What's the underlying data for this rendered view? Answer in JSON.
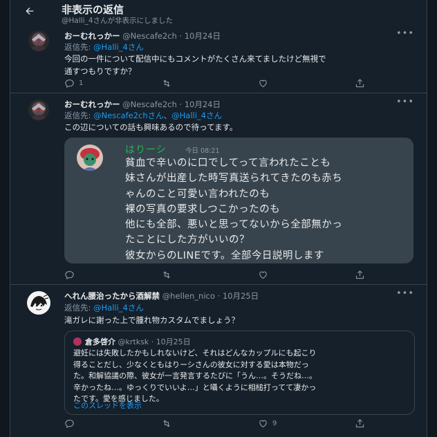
{
  "header": {
    "back_icon": "arrow-left-icon",
    "title": "非表示の返信",
    "subtitle": "@Halli_4さんが非表示にしました"
  },
  "tweets": [
    {
      "name": "おーむれっかー",
      "handle": "@Nescafe2ch",
      "sep": "·",
      "date": "10月24日",
      "reply_prefix": "返信先: ",
      "mentions": [
        "@Halli_4さん"
      ],
      "text": [
        "今回の一件について配信中にもコメントがたくさん来てましたけど無視で",
        "通すつもりですか？"
      ],
      "actions": {
        "reply": "1",
        "retweet": "",
        "like": ""
      }
    },
    {
      "name": "おーむれっかー",
      "handle": "@Nescafe2ch",
      "sep": "·",
      "date": "10月24日",
      "reply_prefix": "返信先: ",
      "mention_1": "@Nescafe2chさん",
      "joiner": "、",
      "mention_2": "@Halli_4さん",
      "text": [
        "この辺についての話も興味あるので待ってます。"
      ],
      "chat_image": {
        "sender": "はりーシ",
        "time": "今日 08:21",
        "lines": [
          "貧血で辛いのに口でしてって言われたことも",
          "妹さんが出産した時写真送られてきたのも赤ち",
          "ゃんのこと可愛い言われたのも",
          "裸の写真の要求しつこかったのも",
          "他にも全部、悪いと思ってないから全部無かっ",
          "たことにした方がいいの？",
          "彼女からのLINEです。全部今日説明します"
        ]
      },
      "actions": {
        "reply": "",
        "retweet": "",
        "like": ""
      }
    },
    {
      "name": "へれん腰治ったから酒解禁",
      "handle": "@hellen_nico",
      "sep": "·",
      "date": "10月25日",
      "reply_prefix": "返信先: ",
      "mentions": [
        "@Halli_4さん"
      ],
      "text": [
        "滝ガレに謝った上で腫れ物カスタムでましょう？"
      ],
      "quote": {
        "name": "倉多啓介",
        "handle": "@krtksk",
        "sep": "·",
        "date": "10月25日",
        "lines": [
          "避妊には失敗したかもしれないけど、それはどんなカップルにも起こり",
          "得ることだし、少なくともはりーシさんの彼女に対する愛は本物だっ",
          "た。和解協議の際、彼女が一言発言するたびに「うん…。そうだね…。",
          "辛かったね…。ゆっくりでいいよ…」と囁くように相槌打ってて凄かっ",
          "たです。愛を感じました。"
        ],
        "show_thread": "このスレッドを表示"
      },
      "actions": {
        "reply": "",
        "retweet": "",
        "like": "9"
      }
    }
  ],
  "icons": {
    "more": "more-horizontal-icon",
    "reply": "reply-icon",
    "retweet": "retweet-icon",
    "like": "heart-icon",
    "share": "share-icon"
  },
  "colors": {
    "background": "#15202b",
    "accent": "#1d9bf0",
    "muted": "#8b98a5",
    "border": "#38444d",
    "chat_name": "#1db954"
  }
}
